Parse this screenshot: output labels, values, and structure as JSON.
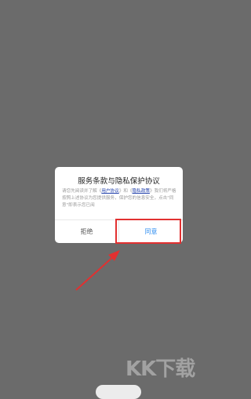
{
  "dialog": {
    "title": "服务条款与隐私保护协议",
    "body_prefix": "请您先阅读并了解《",
    "user_agreement_link": "用户协议",
    "body_mid": "》和《",
    "privacy_policy_link": "隐私政策",
    "body_suffix": "》我们将严格按照上述协议为您提供服务，保护您的信息安全，点击\"同意\"即表示您已阅",
    "reject_label": "拒绝",
    "agree_label": "同意"
  },
  "watermark": {
    "text": "KK下载"
  },
  "colors": {
    "overlay": "#6b6b6b",
    "link": "#1a3aa8",
    "agree": "#2d8cf0",
    "annotation": "#e23030"
  }
}
